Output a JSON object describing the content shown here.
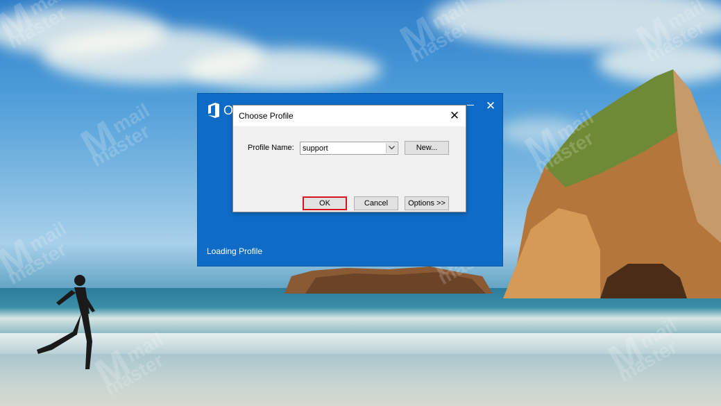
{
  "splash": {
    "title": "O",
    "status": "Loading Profile",
    "close_glyph": "✕"
  },
  "dialog": {
    "title": "Choose Profile",
    "close_glyph": "✕",
    "profile_label": "Profile Name:",
    "profile_value": "support",
    "new_button": "New...",
    "ok_button": "OK",
    "cancel_button": "Cancel",
    "options_button": "Options >>"
  },
  "watermark": {
    "line1": "mail",
    "line2": "master"
  },
  "colors": {
    "splash_background": "#0f6cc6",
    "dialog_background": "#f0f0f0",
    "ok_highlight": "#d6141f"
  },
  "icons": {
    "splash_logo": "office-logo-icon",
    "splash_minimize": "minimize-icon",
    "splash_close": "close-icon",
    "dialog_close": "close-icon",
    "dropdown": "chevron-down-icon"
  }
}
